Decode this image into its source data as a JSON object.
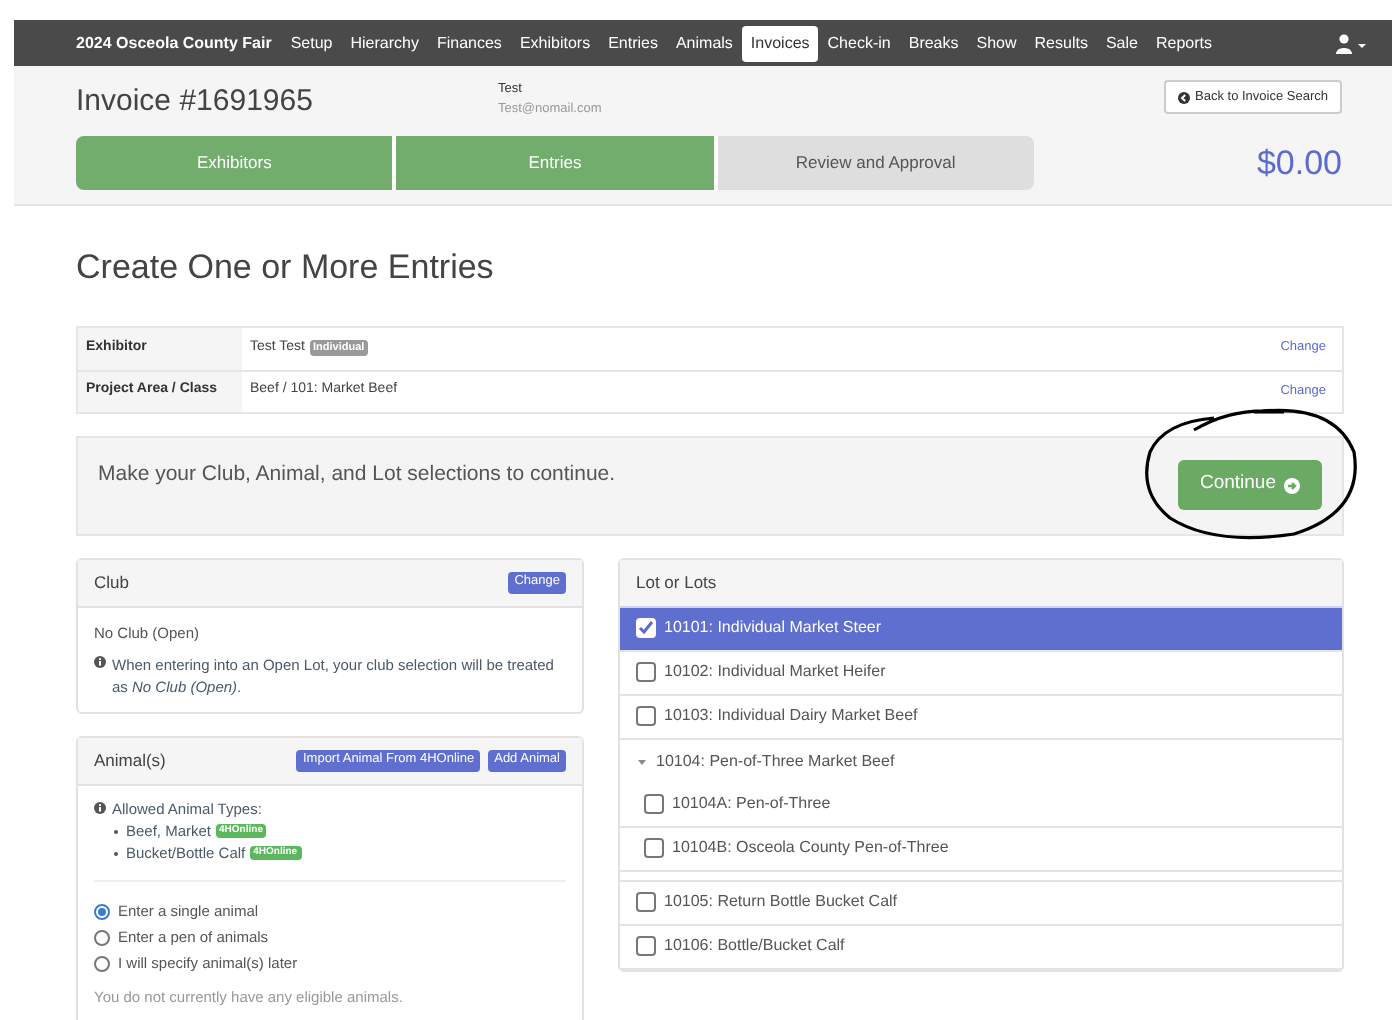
{
  "navbar": {
    "brand": "2024 Osceola County Fair",
    "items": [
      {
        "label": "Setup",
        "selected": false
      },
      {
        "label": "Hierarchy",
        "selected": false
      },
      {
        "label": "Finances",
        "selected": false
      },
      {
        "label": "Exhibitors",
        "selected": false
      },
      {
        "label": "Entries",
        "selected": false
      },
      {
        "label": "Animals",
        "selected": false
      },
      {
        "label": "Invoices",
        "selected": true
      },
      {
        "label": "Check-in",
        "selected": false
      },
      {
        "label": "Breaks",
        "selected": false
      },
      {
        "label": "Show",
        "selected": false
      },
      {
        "label": "Results",
        "selected": false
      },
      {
        "label": "Sale",
        "selected": false
      },
      {
        "label": "Reports",
        "selected": false
      }
    ]
  },
  "header": {
    "title": "Invoice #1691965",
    "customer_name": "Test",
    "customer_email": "Test@nomail.com",
    "back_button": "Back to Invoice Search",
    "total": "$0.00",
    "steps": [
      {
        "label": "Exhibitors",
        "done": true
      },
      {
        "label": "Entries",
        "done": true
      },
      {
        "label": "Review and Approval",
        "done": false
      }
    ]
  },
  "page_title": "Create One or More Entries",
  "summary": {
    "rows": [
      {
        "label": "Exhibitor",
        "value": "Test Test",
        "badge": "Individual",
        "action": "Change"
      },
      {
        "label": "Project Area / Class",
        "value": "Beef  /  101: Market Beef",
        "action": "Change"
      }
    ]
  },
  "notice": {
    "text": "Make your Club, Animal, and Lot selections to continue.",
    "button": "Continue"
  },
  "club": {
    "title": "Club",
    "button": "Change",
    "value": "No Club (Open)",
    "info": "When entering into an Open Lot, your club selection will be treated as *No Club (Open)*."
  },
  "animals": {
    "title": "Animal(s)",
    "buttons": [
      "Import Animal From 4HOnline",
      "Add Animal"
    ],
    "allowed_label": "Allowed Animal Types:",
    "types": [
      {
        "name": "Beef, Market",
        "badge": "4HOnline"
      },
      {
        "name": "Bucket/Bottle Calf",
        "badge": "4HOnline"
      }
    ],
    "options": [
      {
        "label": "Enter a single animal",
        "selected": true
      },
      {
        "label": "Enter a pen of animals",
        "selected": false
      },
      {
        "label": "I will specify animal(s) later",
        "selected": false
      }
    ],
    "note": "You do not currently have any eligible animals."
  },
  "lots": {
    "title": "Lot or Lots",
    "items": [
      {
        "label": "10101: Individual Market Steer",
        "checked": true,
        "selected": true
      },
      {
        "label": "10102: Individual Market Heifer",
        "checked": false,
        "selected": false
      },
      {
        "label": "10103: Individual Dairy Market Beef",
        "checked": false,
        "selected": false
      },
      {
        "label": "10104: Pen-of-Three Market Beef",
        "expanded": true,
        "children": [
          {
            "label": "10104A: Pen-of-Three",
            "checked": false,
            "selected": false
          },
          {
            "label": "10104B: Osceola County Pen-of-Three",
            "checked": false,
            "selected": false
          }
        ]
      },
      {
        "label": "10105: Return Bottle Bucket Calf",
        "checked": false,
        "selected": false
      },
      {
        "label": "10106: Bottle/Bucket Calf",
        "checked": false,
        "selected": false
      }
    ]
  }
}
